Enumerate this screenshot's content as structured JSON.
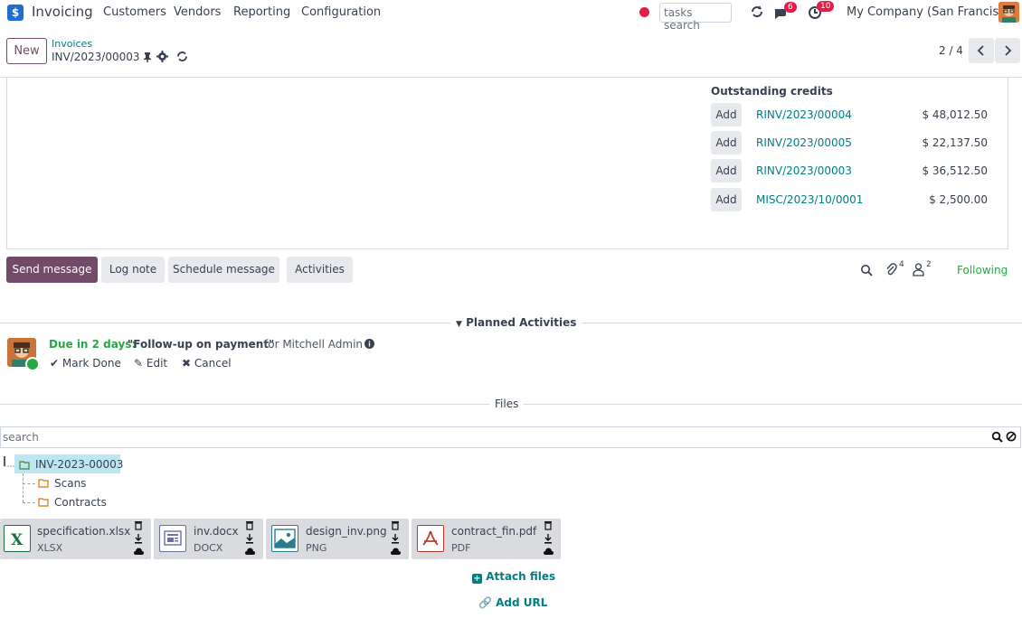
{
  "navbar": {
    "app_name": "Invoicing",
    "menu": [
      "Customers",
      "Vendors",
      "Reporting",
      "Configuration"
    ],
    "search_placeholder": "tasks search",
    "chat_badge": "6",
    "activity_badge": "10",
    "company": "My Company (San Francisco)"
  },
  "control_panel": {
    "new_label": "New",
    "breadcrumb_parent": "Invoices",
    "breadcrumb_current": "INV/2023/00003",
    "pager": "2 / 4"
  },
  "outstanding_credits": {
    "title": "Outstanding credits",
    "add_label": "Add",
    "rows": [
      {
        "ref": "RINV/2023/00004",
        "amount": "$ 48,012.50"
      },
      {
        "ref": "RINV/2023/00005",
        "amount": "$ 22,137.50"
      },
      {
        "ref": "RINV/2023/00003",
        "amount": "$ 36,512.50"
      },
      {
        "ref": "MISC/2023/10/0001",
        "amount": "$ 2,500.00"
      }
    ]
  },
  "chatter": {
    "send_message": "Send message",
    "log_note": "Log note",
    "schedule_message": "Schedule message",
    "activities": "Activities",
    "attachments_count": "4",
    "followers_count": "2",
    "following": "Following"
  },
  "planned": {
    "header": "Planned Activities",
    "due": "Due in 2 days:",
    "summary": "\"Follow-up on payment\"",
    "for": "for Mitchell Admin",
    "mark_done": "Mark Done",
    "edit": "Edit",
    "cancel": "Cancel"
  },
  "files": {
    "header": "Files",
    "search_placeholder": "search",
    "tree": {
      "root": "INV-2023-00003",
      "children": [
        "Scans",
        "Contracts"
      ]
    },
    "cards": [
      {
        "name": "specification.xlsx",
        "ext": "XLSX",
        "icon": "excel-icon"
      },
      {
        "name": "inv.docx",
        "ext": "DOCX",
        "icon": "document-icon"
      },
      {
        "name": "design_inv.png",
        "ext": "PNG",
        "icon": "image-icon"
      },
      {
        "name": "contract_fin.pdf",
        "ext": "PDF",
        "icon": "pdf-icon"
      }
    ],
    "attach_files": "Attach files",
    "add_url": "Add URL"
  },
  "colors": {
    "brand": "#714b67",
    "link": "#017e84",
    "success": "#28a745",
    "badge": "#e11d48"
  }
}
